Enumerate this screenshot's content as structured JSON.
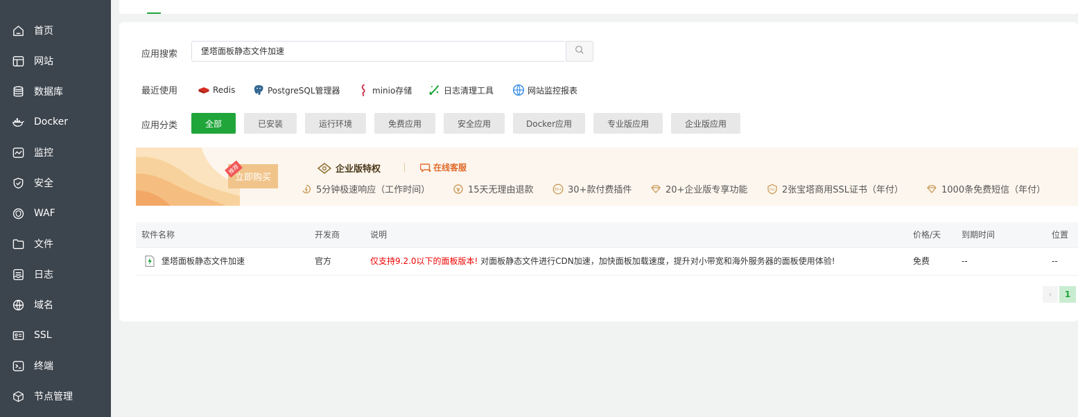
{
  "sidebar": {
    "items": [
      {
        "label": "首页",
        "icon": "home-icon"
      },
      {
        "label": "网站",
        "icon": "website-icon"
      },
      {
        "label": "数据库",
        "icon": "database-icon"
      },
      {
        "label": "Docker",
        "icon": "docker-icon"
      },
      {
        "label": "监控",
        "icon": "monitor-icon"
      },
      {
        "label": "安全",
        "icon": "shield-icon"
      },
      {
        "label": "WAF",
        "icon": "waf-icon"
      },
      {
        "label": "文件",
        "icon": "folder-icon"
      },
      {
        "label": "日志",
        "icon": "log-icon"
      },
      {
        "label": "域名",
        "icon": "globe-icon"
      },
      {
        "label": "SSL",
        "icon": "ssl-icon"
      },
      {
        "label": "终端",
        "icon": "terminal-icon"
      },
      {
        "label": "节点管理",
        "icon": "cube-icon"
      }
    ]
  },
  "search": {
    "label": "应用搜索",
    "value": "堡塔面板静态文件加速"
  },
  "recent": {
    "label": "最近使用",
    "items": [
      {
        "label": "Redis",
        "icon": "redis-icon"
      },
      {
        "label": "PostgreSQL管理器",
        "icon": "postgresql-icon"
      },
      {
        "label": "minio存储",
        "icon": "minio-icon"
      },
      {
        "label": "日志清理工具",
        "icon": "log-cleaner-icon"
      },
      {
        "label": "网站监控报表",
        "icon": "site-monitor-icon"
      }
    ]
  },
  "categories": {
    "label": "应用分类",
    "items": [
      "全部",
      "已安装",
      "运行环境",
      "免费应用",
      "安全应用",
      "Docker应用",
      "专业版应用",
      "企业版应用"
    ],
    "active": "全部"
  },
  "banner": {
    "tag": "推荐",
    "buy": "立即购买",
    "title": "企业版特权",
    "service": "在线客服",
    "features": [
      "5分钟极速响应（工作时间）",
      "15天无理由退款",
      "30+款付费插件",
      "20+企业版专享功能",
      "2张宝塔商用SSL证书（年付）",
      "1000条免费短信（年付）"
    ]
  },
  "table": {
    "headers": [
      "软件名称",
      "开发商",
      "说明",
      "价格/天",
      "到期时间",
      "位置"
    ],
    "rows": [
      {
        "name": "堡塔面板静态文件加速",
        "vendor": "官方",
        "desc_warning": "仅支持9.2.0以下的面板版本!",
        "desc": " 对面板静态文件进行CDN加速，加快面板加载速度，提升对小带宽和海外服务器的面板使用体验!",
        "price": "免费",
        "expire": "--",
        "location": "--"
      }
    ]
  },
  "pager": {
    "prev": "‹",
    "current": "1"
  },
  "colors": {
    "sidebar": "#3c444d",
    "accent": "#20a53a",
    "warning": "#ee0000",
    "service": "#e06b2c"
  }
}
